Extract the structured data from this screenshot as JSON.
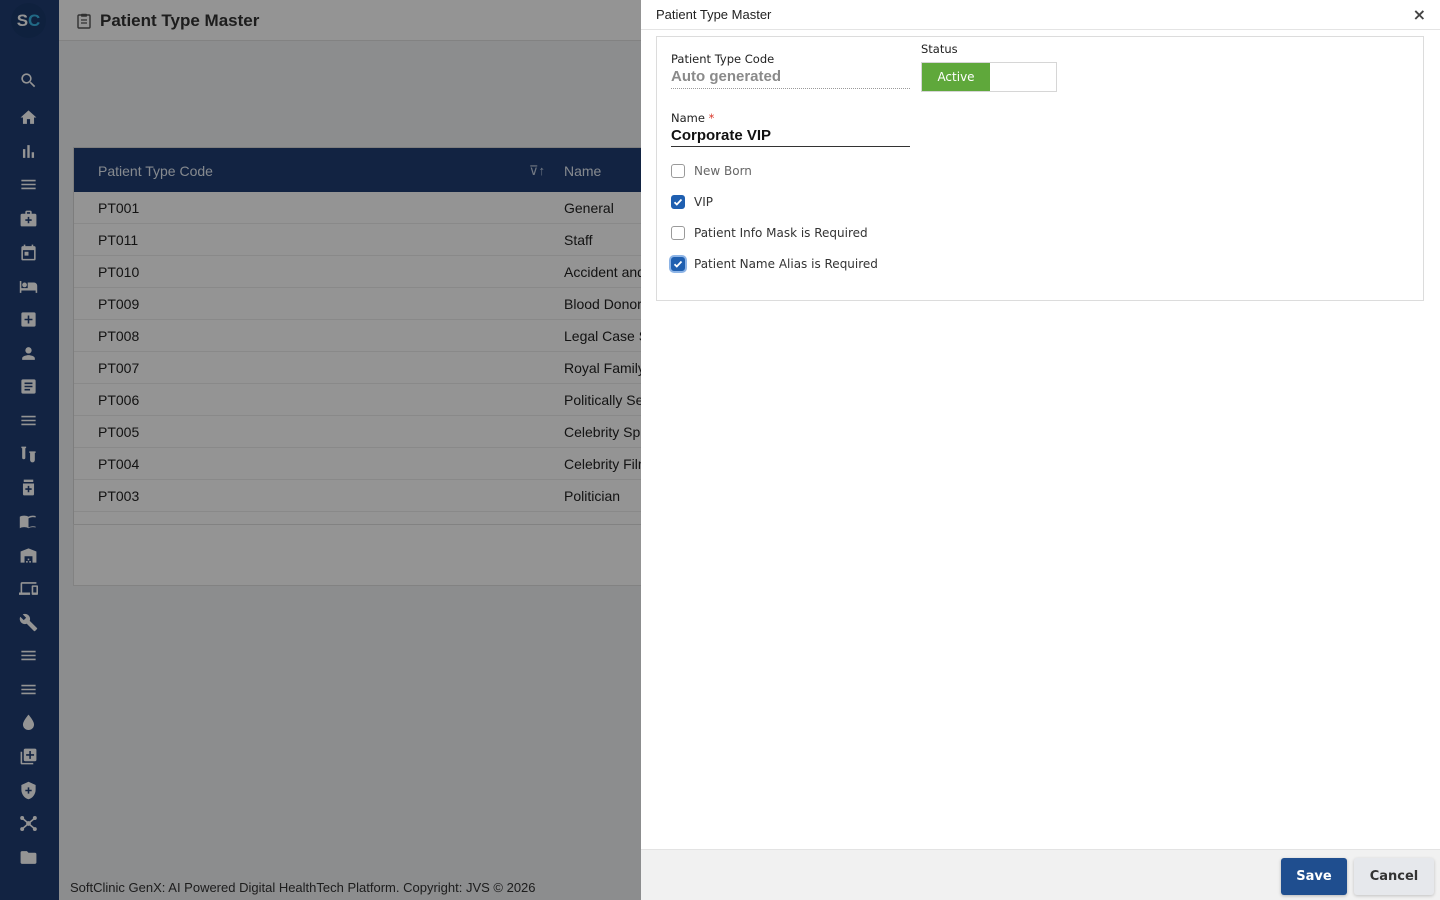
{
  "app": {
    "logo_s": "S",
    "logo_c": "C",
    "page_title": "Patient Type Master",
    "copyright": "SoftClinic GenX: AI Powered Digital HealthTech Platform. Copyright: JVS © 2026"
  },
  "sidebar": {
    "items": [
      {
        "icon": "search-icon"
      },
      {
        "icon": "home-icon"
      },
      {
        "icon": "bar-chart-icon"
      },
      {
        "icon": "menu-icon"
      },
      {
        "icon": "medical-bag-icon"
      },
      {
        "icon": "calendar-icon"
      },
      {
        "icon": "bed-icon"
      },
      {
        "icon": "plus-box-icon"
      },
      {
        "icon": "person-icon"
      },
      {
        "icon": "document-icon"
      },
      {
        "icon": "menu-icon"
      },
      {
        "icon": "lab-icon"
      },
      {
        "icon": "pharmacy-icon"
      },
      {
        "icon": "book-icon"
      },
      {
        "icon": "warehouse-icon"
      },
      {
        "icon": "devices-icon"
      },
      {
        "icon": "wrench-icon"
      },
      {
        "icon": "menu-icon"
      },
      {
        "icon": "menu-icon"
      },
      {
        "icon": "blood-drop-icon"
      },
      {
        "icon": "add-library-icon"
      },
      {
        "icon": "shield-icon"
      },
      {
        "icon": "network-icon"
      },
      {
        "icon": "folder-icon"
      }
    ]
  },
  "grid": {
    "headers": {
      "code": "Patient Type Code",
      "name": "Name"
    },
    "rows": [
      {
        "code": "PT001",
        "name": "General"
      },
      {
        "code": "PT011",
        "name": "Staff"
      },
      {
        "code": "PT010",
        "name": "Accident and"
      },
      {
        "code": "PT009",
        "name": "Blood Donor"
      },
      {
        "code": "PT008",
        "name": "Legal Case S"
      },
      {
        "code": "PT007",
        "name": "Royal Family"
      },
      {
        "code": "PT006",
        "name": "Politically Se"
      },
      {
        "code": "PT005",
        "name": "Celebrity Sp"
      },
      {
        "code": "PT004",
        "name": "Celebrity Film"
      },
      {
        "code": "PT003",
        "name": "Politician"
      }
    ]
  },
  "drawer": {
    "title": "Patient Type Master",
    "close": "×",
    "code_label": "Patient Type Code",
    "code_value": "Auto generated",
    "status_label": "Status",
    "status_active": "Active",
    "name_label": "Name",
    "name_required": "*",
    "name_value": "Corporate VIP",
    "checkboxes": [
      {
        "label": "New Born",
        "checked": false
      },
      {
        "label": "VIP",
        "checked": true
      },
      {
        "label": "Patient Info Mask is Required",
        "checked": false
      },
      {
        "label": "Patient Name Alias is Required",
        "checked": true
      }
    ],
    "save": "Save",
    "cancel": "Cancel"
  },
  "colors": {
    "sidebar": "#1f3d73",
    "grid_header": "#1f3d73",
    "status_active": "#5fa83b",
    "save_button": "#1f4e8f",
    "checkbox_checked": "#1f5fb0"
  }
}
